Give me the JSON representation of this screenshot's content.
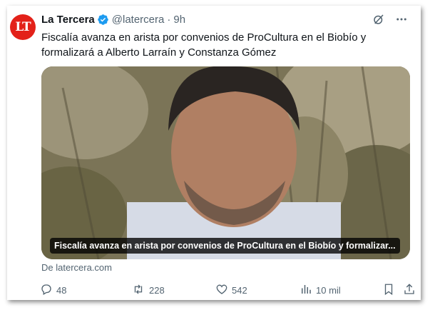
{
  "account": {
    "avatar_text": "LT",
    "name": "La Tercera",
    "handle": "@latercera",
    "separator": "·",
    "time": "9h"
  },
  "icons": {
    "verified": "verified-badge-icon",
    "grok": "grok-icon",
    "more": "more-icon",
    "reply": "reply-icon",
    "retweet": "retweet-icon",
    "like": "like-icon",
    "views": "views-icon",
    "bookmark": "bookmark-icon",
    "share": "share-icon"
  },
  "tweet": {
    "text": "Fiscalía avanza en arista por convenios de ProCultura en el Biobío y formalizará a Alberto Larraín y Constanza Gómez"
  },
  "media": {
    "caption": "Fiscalía avanza en arista por convenios de ProCultura en el Biobío y formalizar..."
  },
  "link": {
    "source": "De latercera.com"
  },
  "stats": {
    "replies": "48",
    "retweets": "228",
    "likes": "542",
    "views": "10 mil"
  },
  "colors": {
    "avatar_bg": "#e32119",
    "verified": "#1d9bf0",
    "muted_text": "#536471",
    "primary_text": "#0f1419"
  }
}
